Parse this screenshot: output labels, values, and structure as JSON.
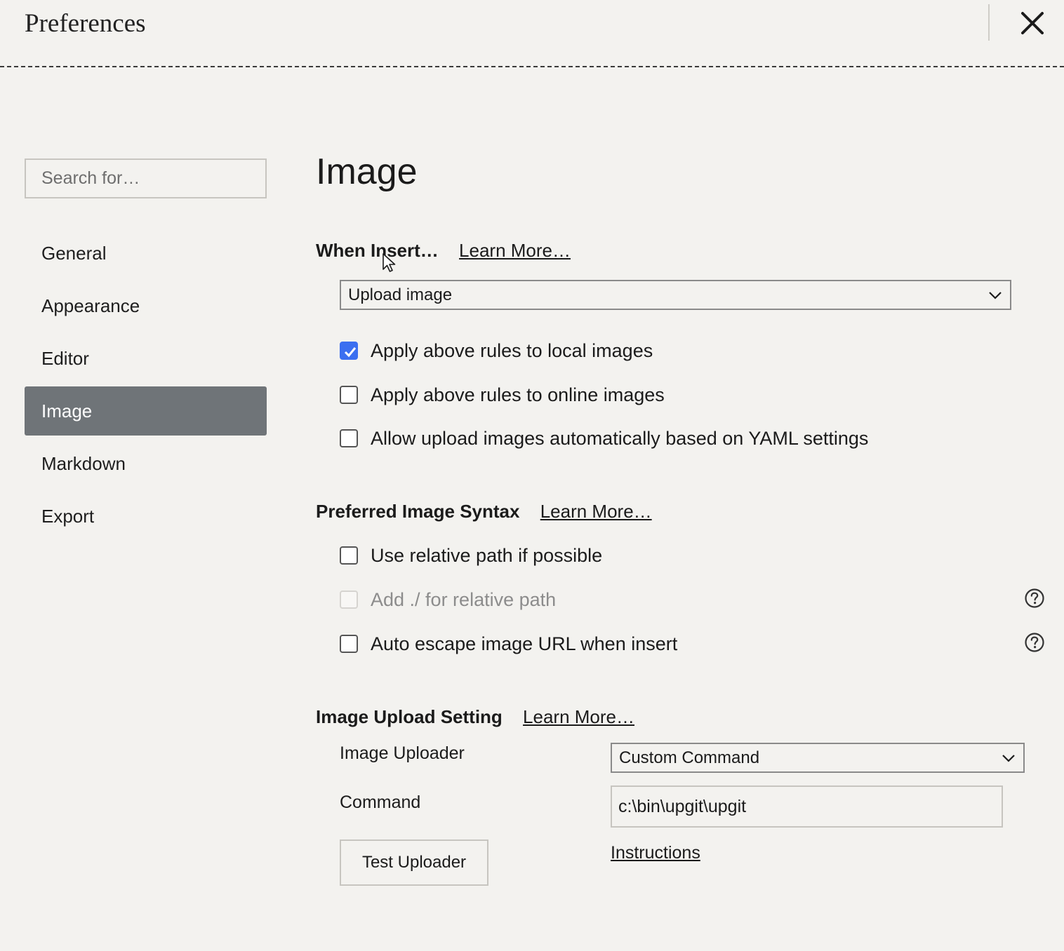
{
  "window": {
    "title": "Preferences",
    "close_icon": "close-icon"
  },
  "sidebar": {
    "search_placeholder": "Search for…",
    "items": [
      {
        "label": "General",
        "active": false
      },
      {
        "label": "Appearance",
        "active": false
      },
      {
        "label": "Editor",
        "active": false
      },
      {
        "label": "Image",
        "active": true
      },
      {
        "label": "Markdown",
        "active": false
      },
      {
        "label": "Export",
        "active": false
      }
    ]
  },
  "main": {
    "title": "Image",
    "when_insert": {
      "heading": "When Insert…",
      "learn_more": "Learn More…",
      "select_value": "Upload image",
      "options": [
        {
          "label": "Apply above rules to local images",
          "checked": true,
          "disabled": false
        },
        {
          "label": "Apply above rules to online images",
          "checked": false,
          "disabled": false
        },
        {
          "label": "Allow upload images automatically based on YAML settings",
          "checked": false,
          "disabled": false
        }
      ]
    },
    "syntax": {
      "heading": "Preferred Image Syntax",
      "learn_more": "Learn More…",
      "options": [
        {
          "label": "Use relative path if possible",
          "checked": false,
          "disabled": false,
          "help": false
        },
        {
          "label": "Add ./ for relative path",
          "checked": false,
          "disabled": true,
          "help": true
        },
        {
          "label": "Auto escape image URL when insert",
          "checked": false,
          "disabled": false,
          "help": true
        }
      ]
    },
    "upload": {
      "heading": "Image Upload Setting",
      "learn_more": "Learn More…",
      "uploader_label": "Image Uploader",
      "uploader_value": "Custom Command",
      "command_label": "Command",
      "command_value": "c:\\bin\\upgit\\upgit",
      "test_button": "Test Uploader",
      "instructions_link": "Instructions"
    }
  },
  "colors": {
    "background": "#f3f2ef",
    "active_nav": "#6f7478",
    "checkbox_checked": "#3b6ff0"
  }
}
